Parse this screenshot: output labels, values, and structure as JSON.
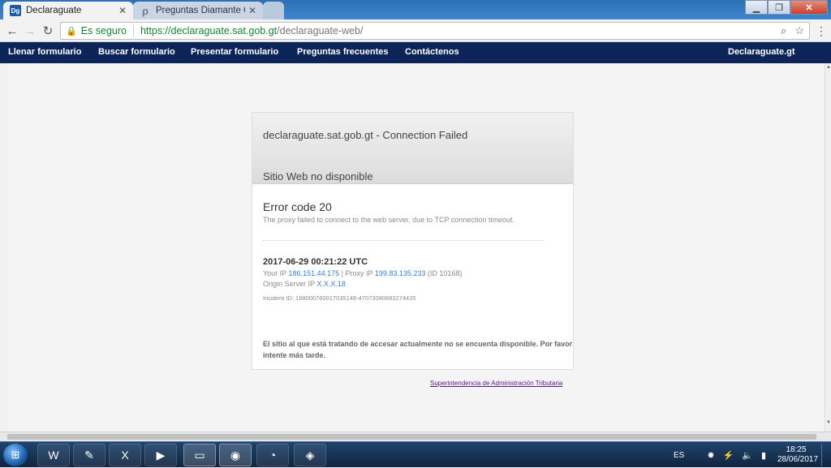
{
  "browser": {
    "tabs": [
      {
        "label": "Declaraguate",
        "favicon": "Dg",
        "active": true
      },
      {
        "label": "Preguntas Diamante Con",
        "favicon": "ρ",
        "active": false
      }
    ],
    "secure_label": "Es seguro",
    "url_host": "https://declaraguate.sat.gob.gt",
    "url_path": "/declaraguate-web/"
  },
  "site_nav": {
    "items": [
      "Llenar formulario",
      "Buscar formulario",
      "Presentar formulario",
      "Preguntas frecuentes",
      "Contáctenos"
    ],
    "brand": "Declaraguate.gt"
  },
  "error_card": {
    "title": "declaraguate.sat.gob.gt - Connection Failed",
    "subtitle": "Sitio Web no disponible",
    "code": "Error code 20",
    "description": "The proxy failed to connect to the web server, due to TCP connection timeout.",
    "timestamp": "2017-06-29 00:21:22 UTC",
    "your_ip_label": "Your IP",
    "your_ip": "186.151.44.175",
    "proxy_ip_label": "| Proxy IP",
    "proxy_ip": "199.83.135.233",
    "proxy_id": "(ID 10168)",
    "origin_label": "Origin Server IP",
    "origin_ip": "X.X.X.18",
    "incident": "Incident ID: 168000760017035148-47073090683274435",
    "message": "El sitio al que está tratando de accesar actualmente no se encuenta disponible. Por favor intente más tarde."
  },
  "footer_link": "Superintendencia de Administración Tributaria",
  "taskbar": {
    "lang": "ES",
    "time": "18:25",
    "date": "28/06/2017"
  },
  "colors": {
    "site_nav_bg": "#0c2458",
    "secure_green": "#188038",
    "link_blue": "#3a7ec5"
  }
}
